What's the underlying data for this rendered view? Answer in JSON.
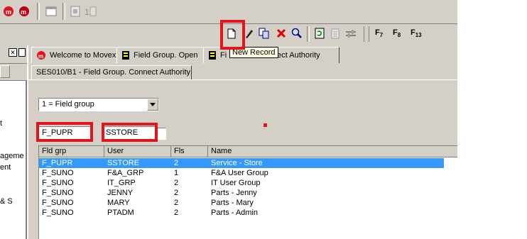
{
  "toolbar": {
    "top_buttons": [
      {
        "icon": "movex-m-icon"
      },
      {
        "icon": "movex-m-red-icon"
      },
      {
        "icon": "window-icon"
      },
      {
        "icon": "document-icon"
      },
      {
        "icon": "document-1-icon"
      }
    ],
    "function_keys": {
      "f7": "F",
      "f7_sub": "7",
      "f8": "F",
      "f8_sub": "8",
      "f13": "F",
      "f13_sub": "13"
    }
  },
  "tooltip": {
    "text": "New Record"
  },
  "tabs": [
    {
      "label": "Welcome to Movex",
      "icon": "movex-logo-icon"
    },
    {
      "label": "Field Group. Open",
      "icon": "program-icon"
    },
    {
      "label": "Fi",
      "icon": "program-icon"
    },
    {
      "label": "nect Authority"
    }
  ],
  "subtab": {
    "label": "SES010/B1 - Field Group. Connect Authority"
  },
  "sort_select": {
    "value": "1 = Field group"
  },
  "filters": {
    "field_group": "F_PUPR",
    "user": "SSTORE",
    "third": ""
  },
  "grid": {
    "columns": [
      "Fld grp",
      "User",
      "Fls",
      "Name"
    ],
    "rows": [
      {
        "fld_grp": "F_PUPR",
        "user": "SSTORE",
        "fls": "2",
        "name": "Service - Store",
        "selected": true
      },
      {
        "fld_grp": "F_SUNO",
        "user": "F&A_GRP",
        "fls": "1",
        "name": "F&A User Group"
      },
      {
        "fld_grp": "F_SUNO",
        "user": "IT_GRP",
        "fls": "2",
        "name": "IT User Group"
      },
      {
        "fld_grp": "F_SUNO",
        "user": "JENNY",
        "fls": "2",
        "name": "Parts - Jenny"
      },
      {
        "fld_grp": "F_SUNO",
        "user": "MARY",
        "fls": "2",
        "name": "Parts - Mary"
      },
      {
        "fld_grp": "F_SUNO",
        "user": "PTADM",
        "fls": "2",
        "name": "Parts - Admin"
      }
    ]
  },
  "left_panel": {
    "fragments": [
      "t",
      "ageme",
      "ent",
      "& S"
    ]
  },
  "colors": {
    "highlight_red": "#e3131b",
    "selection_blue": "#3399ff",
    "chrome": "#d4d0c8"
  }
}
